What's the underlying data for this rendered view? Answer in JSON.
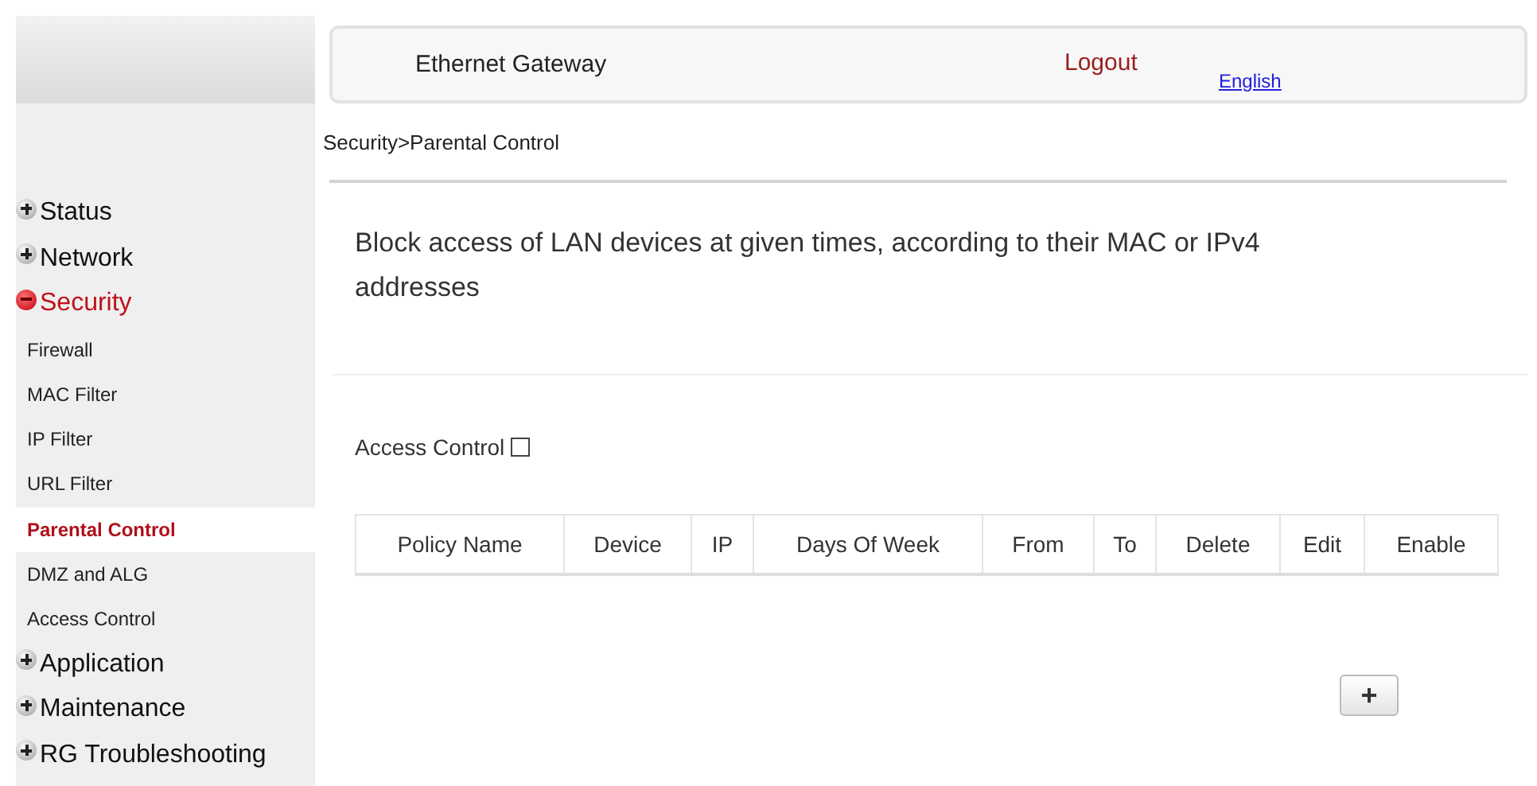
{
  "header": {
    "title": "Ethernet Gateway",
    "logout": "Logout",
    "language": "English"
  },
  "sidebar": {
    "items": [
      {
        "label": "Status",
        "expanded": false
      },
      {
        "label": "Network",
        "expanded": false
      },
      {
        "label": "Security",
        "expanded": true,
        "children": [
          {
            "label": "Firewall",
            "selected": false
          },
          {
            "label": "MAC Filter",
            "selected": false
          },
          {
            "label": "IP Filter",
            "selected": false
          },
          {
            "label": "URL Filter",
            "selected": false
          },
          {
            "label": "Parental Control",
            "selected": true
          },
          {
            "label": "DMZ and ALG",
            "selected": false
          },
          {
            "label": "Access Control",
            "selected": false
          }
        ]
      },
      {
        "label": "Application",
        "expanded": false
      },
      {
        "label": "Maintenance",
        "expanded": false
      },
      {
        "label": "RG Troubleshooting",
        "expanded": false
      }
    ]
  },
  "breadcrumb": "Security>Parental Control",
  "description": "Block access of LAN devices at given times, according to their MAC or IPv4 addresses",
  "access_control": {
    "label": "Access Control",
    "checked": false
  },
  "table": {
    "columns": [
      "Policy Name",
      "Device",
      "IP",
      "Days Of Week",
      "From",
      "To",
      "Delete",
      "Edit",
      "Enable"
    ]
  },
  "add_button": "+"
}
